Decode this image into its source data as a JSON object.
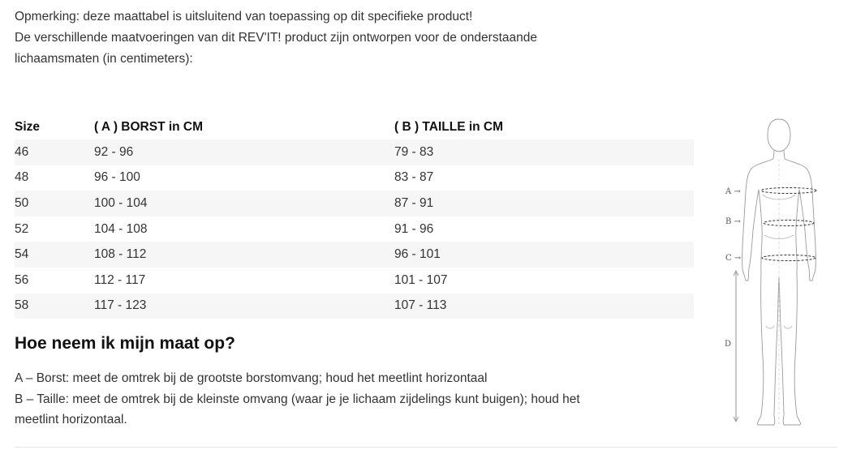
{
  "intro": {
    "line1": "Opmerking: deze maattabel is uitsluitend van toepassing op dit specifieke product!",
    "line2": "De verschillende maatvoeringen van dit REV'IT! product zijn ontworpen voor de onderstaande",
    "line3": "lichaamsmaten (in centimeters):"
  },
  "table": {
    "headers": [
      "Size",
      "( A ) BORST in CM",
      "( B ) TAILLE in CM"
    ],
    "rows": [
      [
        "46",
        "92 - 96",
        "79 - 83"
      ],
      [
        "48",
        "96 - 100",
        "83 - 87"
      ],
      [
        "50",
        "100 - 104",
        "87 - 91"
      ],
      [
        "52",
        "104 - 108",
        "91 - 96"
      ],
      [
        "54",
        "108 - 112",
        "96 - 101"
      ],
      [
        "56",
        "112 - 117",
        "101 - 107"
      ],
      [
        "58",
        "117 - 123",
        "107 - 113"
      ]
    ]
  },
  "howto": {
    "title": "Hoe neem ik mijn maat op?",
    "line_a": "A – Borst: meet de omtrek bij de grootste borstomvang; houd het meetlint horizontaal",
    "line_b1": "B – Taille: meet de omtrek bij de kleinste omvang (waar je je lichaam zijdelings kunt buigen); houd het",
    "line_b2": "meetlint horizontaal."
  },
  "figure": {
    "label_a": "A →",
    "label_b": "B →",
    "label_c": "C →",
    "label_d": "D"
  }
}
